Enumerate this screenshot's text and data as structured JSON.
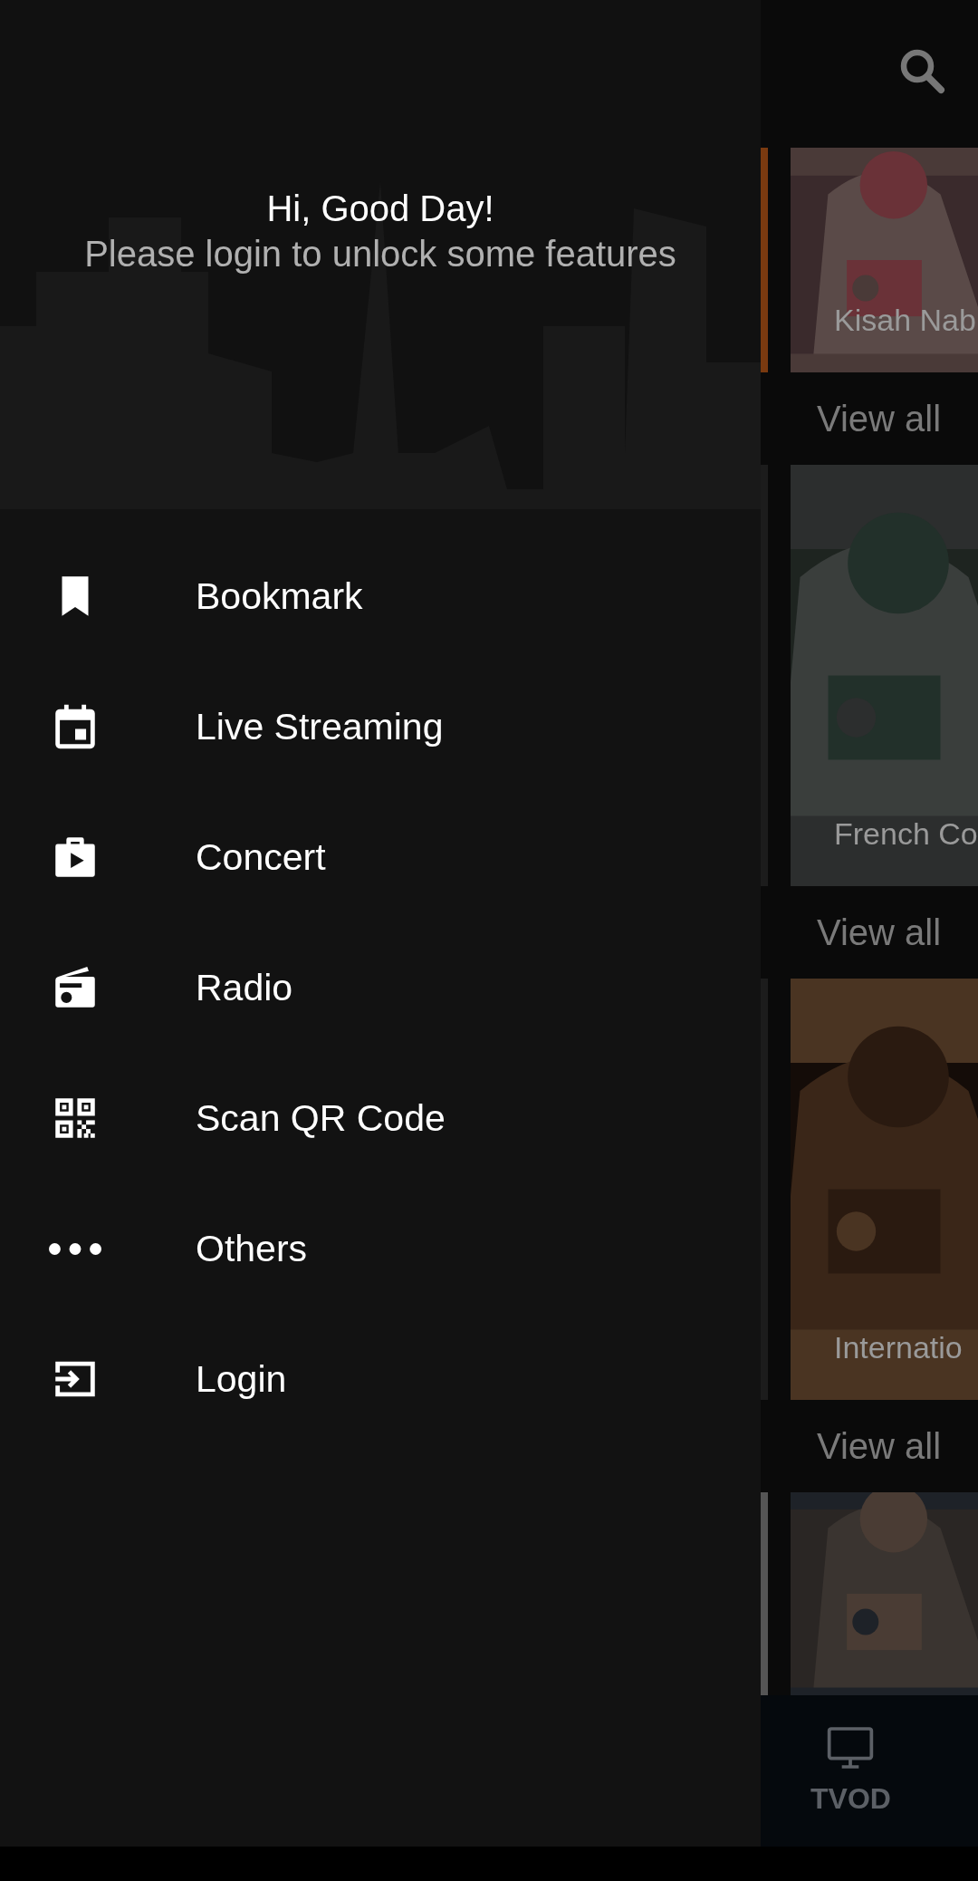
{
  "drawer": {
    "greeting": "Hi, Good Day!",
    "subtitle": "Please login to unlock some features",
    "items": [
      {
        "label": "Bookmark"
      },
      {
        "label": "Live Streaming"
      },
      {
        "label": "Concert"
      },
      {
        "label": "Radio"
      },
      {
        "label": "Scan QR Code"
      },
      {
        "label": "Others"
      },
      {
        "label": "Login"
      }
    ]
  },
  "content": {
    "sections": [
      {
        "title": "Kisah Nab",
        "link": "View all",
        "kind": "picture"
      },
      {
        "title": "French Co",
        "link": "View all",
        "kind": "picture"
      },
      {
        "title": "Internatio",
        "link": "View all",
        "kind": "picture"
      },
      {
        "kind": "picture"
      }
    ]
  },
  "bottom_nav": {
    "items": [
      {
        "label": "TVOD"
      }
    ]
  }
}
